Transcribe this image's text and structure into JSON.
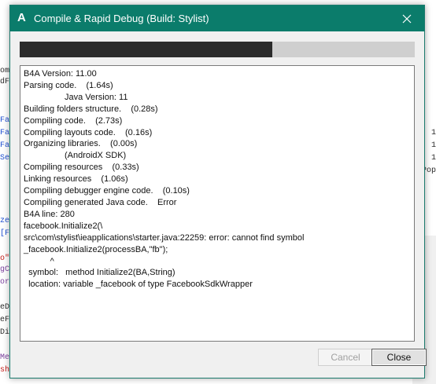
{
  "background": {
    "left_fragments": [
      {
        "text": "om",
        "color": "#2b2b2b"
      },
      {
        "text": "dF",
        "color": "#2b2b2b"
      },
      {
        "text": "Fa",
        "color": "#1f4fd1"
      },
      {
        "text": "Fa",
        "color": "#1f4fd1"
      },
      {
        "text": "Fa",
        "color": "#1f4fd1"
      },
      {
        "text": "Se",
        "color": "#1f4fd1"
      },
      {
        "text": "ze",
        "color": "#1f4fd1"
      },
      {
        "text": "[F",
        "color": "#1f4fd1"
      },
      {
        "text": "o\"",
        "color": "#c41a16"
      },
      {
        "text": "gC",
        "color": "#7a3e9d"
      },
      {
        "text": "or",
        "color": "#7a3e9d"
      },
      {
        "text": "eD",
        "color": "#2b2b2b"
      },
      {
        "text": "eF",
        "color": "#2b2b2b"
      },
      {
        "text": "Di",
        "color": "#2b2b2b"
      },
      {
        "text": "Me",
        "color": "#7a3e9d"
      },
      {
        "text": "sh",
        "color": "#c41a16"
      }
    ],
    "right_fragments": [
      "1",
      "1",
      "1",
      "Pop"
    ]
  },
  "dialog": {
    "app_icon": "A",
    "title": "Compile & Rapid Debug (Build: Stylist)",
    "close_icon": "close-icon",
    "progress": 0.64,
    "log_lines": [
      "B4A Version: 11.00",
      "Parsing code.    (1.64s)",
      "                 Java Version: 11",
      "Building folders structure.    (0.28s)",
      "Compiling code.    (2.73s)",
      "Compiling layouts code.    (0.16s)",
      "Organizing libraries.    (0.00s)",
      "                 (AndroidX SDK)",
      "Compiling resources    (0.33s)",
      "Linking resources    (1.06s)",
      "Compiling debugger engine code.    (0.10s)",
      "Compiling generated Java code.    Error",
      "B4A line: 280",
      "facebook.Initialize2(\\",
      "src\\com\\stylist\\ieapplications\\starter.java:22259: error: cannot find symbol",
      "_facebook.Initialize2(processBA,\"fb\");",
      "           ^",
      "  symbol:   method Initialize2(BA,String)",
      "  location: variable _facebook of type FacebookSdkWrapper"
    ],
    "cancel_label": "Cancel",
    "close_label": "Close"
  }
}
